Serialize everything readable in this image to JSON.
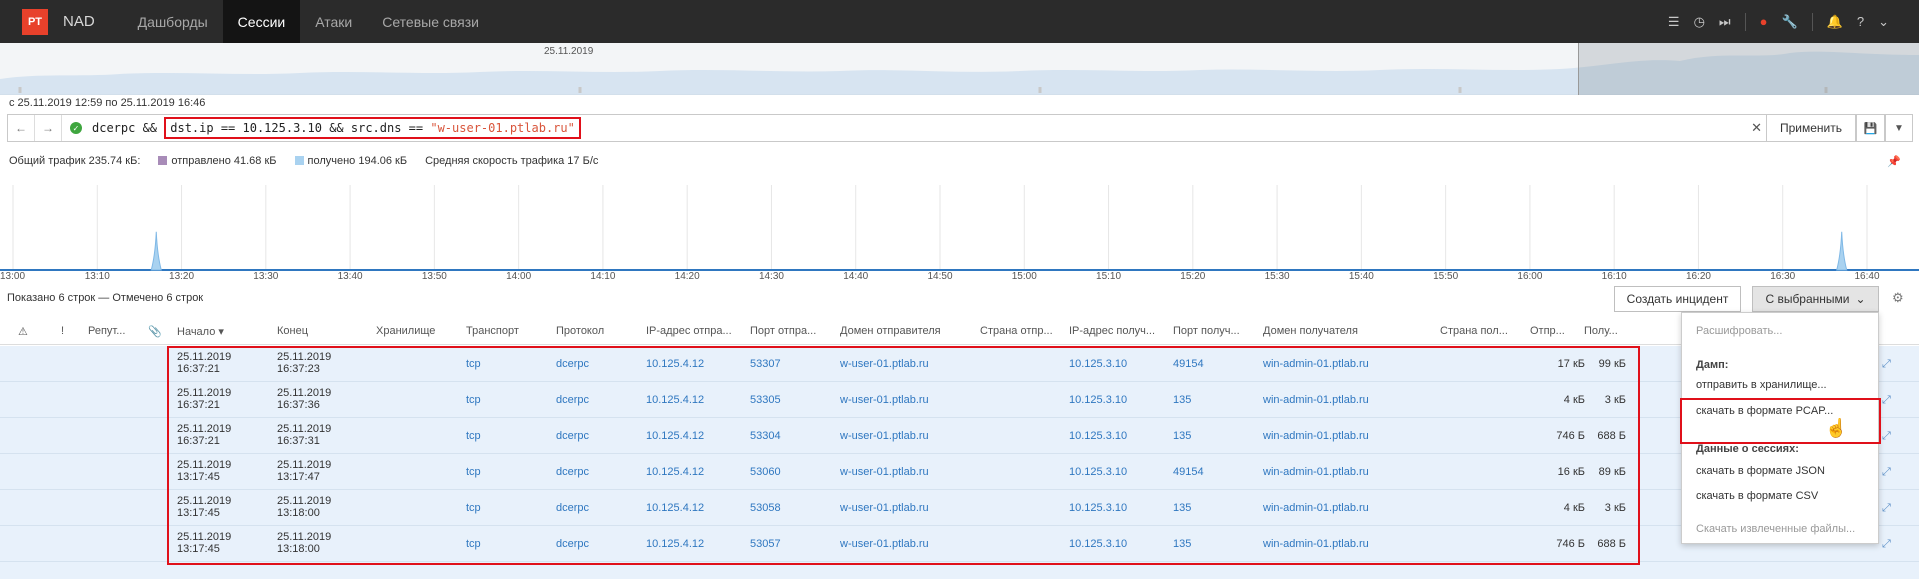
{
  "nav": {
    "logo": "PT",
    "brand": "NAD",
    "tabs": [
      "Дашборды",
      "Сессии",
      "Атаки",
      "Сетевые связи"
    ],
    "active_tab": "Сессии"
  },
  "overview": {
    "date_label": "25.11.2019"
  },
  "period": "с 25.11.2019 12:59 по 25.11.2019 16:46",
  "query": {
    "prefix": "dcerpc && ",
    "highlighted_part1": "dst.ip == 10.125.3.10 && src.dns == ",
    "highlighted_string": "\"w-user-01.ptlab.ru\"",
    "apply_label": "Применить"
  },
  "stats": {
    "total": "Общий трафик 235.74 кБ:",
    "sent": "отправлено 41.68 кБ",
    "received": "получено 194.06 кБ",
    "avg_speed": "Средняя скорость трафика 17 Б/с",
    "sent_color": "#a88cb8",
    "received_color": "#a9d2f0"
  },
  "chart_data": {
    "type": "area",
    "x_ticks": [
      "13:00",
      "13:10",
      "13:20",
      "13:30",
      "13:40",
      "13:50",
      "14:00",
      "14:10",
      "14:20",
      "14:30",
      "14:40",
      "14:50",
      "15:00",
      "15:10",
      "15:20",
      "15:30",
      "15:40",
      "15:50",
      "16:00",
      "16:10",
      "16:20",
      "16:30",
      "16:40"
    ],
    "spikes": [
      {
        "x": "13:17",
        "level": 0.45
      },
      {
        "x": "16:37",
        "level": 0.45
      }
    ]
  },
  "list": {
    "shown_text": "Показано 6 строк — Отмечено 6 строк",
    "create_incident": "Создать инцидент",
    "with_selected": "С выбранными"
  },
  "columns": [
    "Репут...",
    "Начало",
    "Конец",
    "Хранилище",
    "Транспорт",
    "Протокол",
    "IP-адрес отпра...",
    "Порт отпра...",
    "Домен отправителя",
    "Страна отпр...",
    "IP-адрес получ...",
    "Порт получ...",
    "Домен получателя",
    "Страна пол...",
    "Отпр...",
    "Полу..."
  ],
  "rows": [
    {
      "start_d": "25.11.2019",
      "start_t": "16:37:21",
      "end_d": "25.11.2019",
      "end_t": "16:37:23",
      "transport": "tcp",
      "proto": "dcerpc",
      "src_ip": "10.125.4.12",
      "src_port": "53307",
      "src_dns": "w-user-01.ptlab.ru",
      "dst_ip": "10.125.3.10",
      "dst_port": "49154",
      "dst_dns": "win-admin-01.ptlab.ru",
      "sent": "17 кБ",
      "recv": "99 кБ"
    },
    {
      "start_d": "25.11.2019",
      "start_t": "16:37:21",
      "end_d": "25.11.2019",
      "end_t": "16:37:36",
      "transport": "tcp",
      "proto": "dcerpc",
      "src_ip": "10.125.4.12",
      "src_port": "53305",
      "src_dns": "w-user-01.ptlab.ru",
      "dst_ip": "10.125.3.10",
      "dst_port": "135",
      "dst_dns": "win-admin-01.ptlab.ru",
      "sent": "4 кБ",
      "recv": "3 кБ"
    },
    {
      "start_d": "25.11.2019",
      "start_t": "16:37:21",
      "end_d": "25.11.2019",
      "end_t": "16:37:31",
      "transport": "tcp",
      "proto": "dcerpc",
      "src_ip": "10.125.4.12",
      "src_port": "53304",
      "src_dns": "w-user-01.ptlab.ru",
      "dst_ip": "10.125.3.10",
      "dst_port": "135",
      "dst_dns": "win-admin-01.ptlab.ru",
      "sent": "746 Б",
      "recv": "688 Б"
    },
    {
      "start_d": "25.11.2019",
      "start_t": "13:17:45",
      "end_d": "25.11.2019",
      "end_t": "13:17:47",
      "transport": "tcp",
      "proto": "dcerpc",
      "src_ip": "10.125.4.12",
      "src_port": "53060",
      "src_dns": "w-user-01.ptlab.ru",
      "dst_ip": "10.125.3.10",
      "dst_port": "49154",
      "dst_dns": "win-admin-01.ptlab.ru",
      "sent": "16 кБ",
      "recv": "89 кБ"
    },
    {
      "start_d": "25.11.2019",
      "start_t": "13:17:45",
      "end_d": "25.11.2019",
      "end_t": "13:18:00",
      "transport": "tcp",
      "proto": "dcerpc",
      "src_ip": "10.125.4.12",
      "src_port": "53058",
      "src_dns": "w-user-01.ptlab.ru",
      "dst_ip": "10.125.3.10",
      "dst_port": "135",
      "dst_dns": "win-admin-01.ptlab.ru",
      "sent": "4 кБ",
      "recv": "3 кБ"
    },
    {
      "start_d": "25.11.2019",
      "start_t": "13:17:45",
      "end_d": "25.11.2019",
      "end_t": "13:18:00",
      "transport": "tcp",
      "proto": "dcerpc",
      "src_ip": "10.125.4.12",
      "src_port": "53057",
      "src_dns": "w-user-01.ptlab.ru",
      "dst_ip": "10.125.3.10",
      "dst_port": "135",
      "dst_dns": "win-admin-01.ptlab.ru",
      "sent": "746 Б",
      "recv": "688 Б"
    }
  ],
  "dropdown": {
    "decrypt": "Расшифровать...",
    "dump_header": "Дамп:",
    "send_storage": "отправить в хранилище...",
    "download_pcap": "скачать в формате PCAP...",
    "session_header": "Данные о сессиях:",
    "download_json": "скачать в формате JSON",
    "download_csv": "скачать в формате CSV",
    "download_files": "Скачать извлеченные файлы..."
  }
}
